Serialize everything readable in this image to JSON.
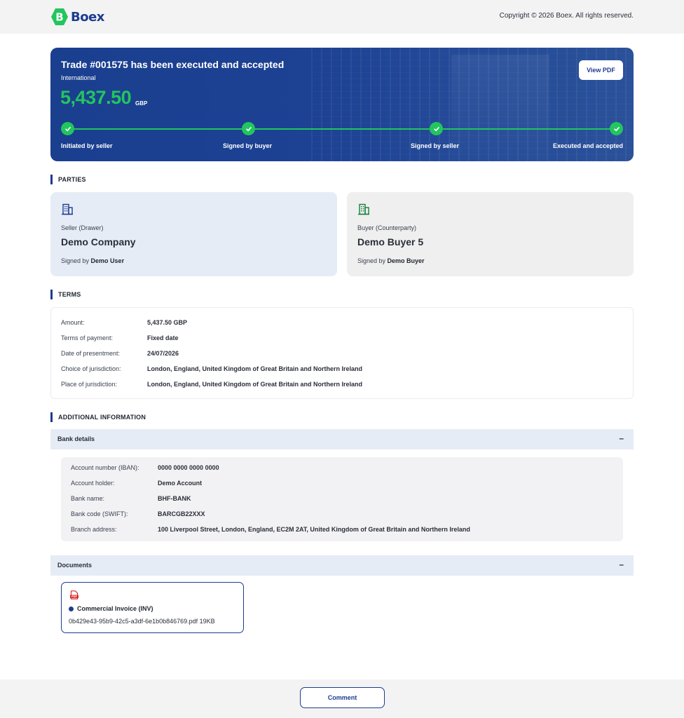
{
  "brand": {
    "name": "Boex",
    "logo_letter": "B"
  },
  "copyright": "Copyright © 2026 Boex. All rights reserved.",
  "trade": {
    "title": "Trade #001575 has been executed and accepted",
    "type": "International",
    "amount": "5,437.50",
    "currency": "GBP",
    "view_pdf_label": "View PDF",
    "steps": [
      "Initiated by seller",
      "Signed by buyer",
      "Signed by seller",
      "Executed and accepted"
    ],
    "progress_completed_steps": 4
  },
  "sections": {
    "parties": "PARTIES",
    "terms": "TERMS",
    "additional": "ADDITIONAL INFORMATION"
  },
  "parties": {
    "seller": {
      "role": "Seller (Drawer)",
      "name": "Demo Company",
      "signed_prefix": "Signed by",
      "signed_by": "Demo User"
    },
    "buyer": {
      "role": "Buyer (Counterparty)",
      "name": "Demo Buyer 5",
      "signed_prefix": "Signed by",
      "signed_by": "Demo Buyer"
    }
  },
  "terms": [
    {
      "label": "Amount:",
      "value": "5,437.50 GBP"
    },
    {
      "label": "Terms of payment:",
      "value": "Fixed date"
    },
    {
      "label": "Date of presentment:",
      "value": "24/07/2026"
    },
    {
      "label": "Choice of jurisdiction:",
      "value": "London, England, United Kingdom of Great Britain and Northern Ireland"
    },
    {
      "label": "Place of jurisdiction:",
      "value": "London, England, United Kingdom of Great Britain and Northern Ireland"
    }
  ],
  "bank": {
    "header": "Bank details",
    "toggle": "–",
    "rows": [
      {
        "label": "Account number (IBAN):",
        "value": "0000 0000 0000 0000"
      },
      {
        "label": "Account holder:",
        "value": "Demo Account"
      },
      {
        "label": "Bank name:",
        "value": "BHF-BANK"
      },
      {
        "label": "Bank code (SWIFT):",
        "value": "BARCGB22XXX"
      },
      {
        "label": "Branch address:",
        "value": "100 Liverpool Street, London, England, EC2M 2AT, United Kingdom of Great Britain and Northern Ireland"
      }
    ]
  },
  "documents": {
    "header": "Documents",
    "toggle": "–",
    "items": [
      {
        "icon": "pdf-file-icon",
        "icon_text": "PDF",
        "title": "Commercial Invoice (INV)",
        "file": "0b429e43-95b9-42c5-a3df-6e1b0b846769.pdf 19KB"
      }
    ]
  },
  "footer": {
    "comment_label": "Comment"
  },
  "colors": {
    "primary": "#1d3c8f",
    "success": "#22c55e",
    "seller_card": "#e6ecf6",
    "buyer_card": "#efefef"
  }
}
